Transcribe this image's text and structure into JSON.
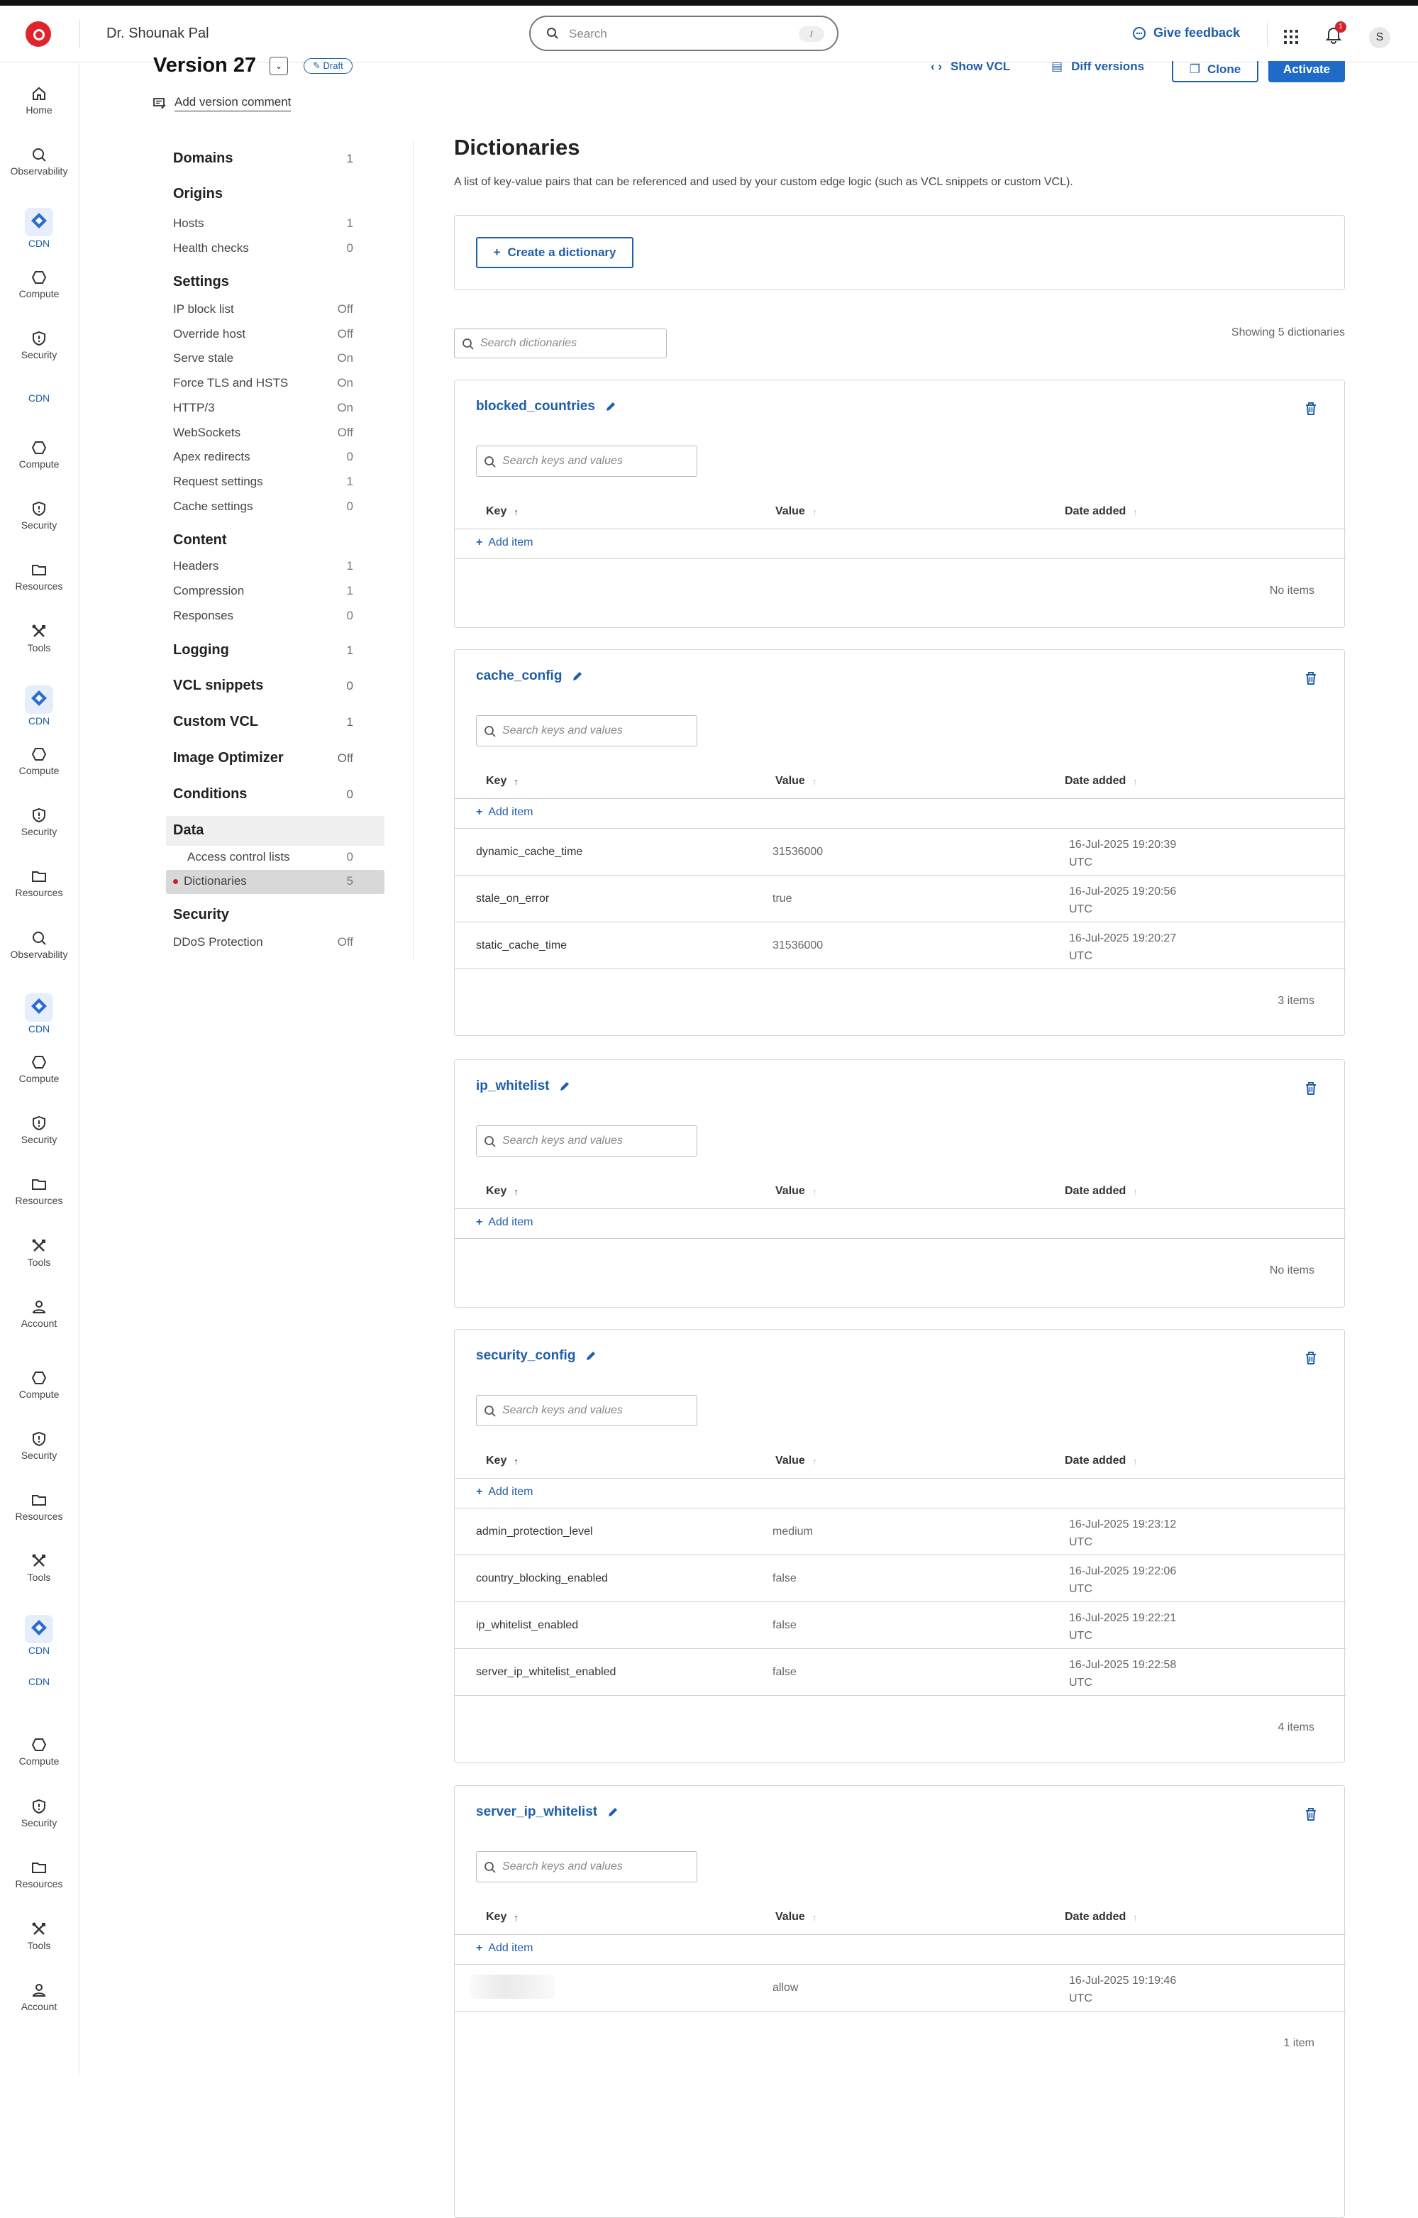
{
  "topbar": {
    "account_name": "Dr. Shounak Pal",
    "search_placeholder": "Search",
    "search_shortcut": "/",
    "feedback_label": "Give feedback",
    "notification_count": "1",
    "avatar_initial": "S"
  },
  "leftnav": {
    "items": [
      {
        "label": "Home",
        "icon": "home-icon"
      },
      {
        "label": "Observability",
        "icon": "observability-icon"
      },
      {
        "label": "CDN",
        "icon": "cdn-icon"
      },
      {
        "label": "Compute",
        "icon": "compute-icon"
      },
      {
        "label": "Security",
        "icon": "shield-icon"
      },
      {
        "label": "CDN",
        "icon": "cdn-text"
      },
      {
        "label": "Compute",
        "icon": "compute-icon"
      },
      {
        "label": "Security",
        "icon": "shield-icon"
      },
      {
        "label": "Resources",
        "icon": "folder-icon"
      },
      {
        "label": "Tools",
        "icon": "tools-icon"
      },
      {
        "label": "CDN",
        "icon": "cdn-icon"
      },
      {
        "label": "Compute",
        "icon": "compute-icon"
      },
      {
        "label": "Security",
        "icon": "shield-icon"
      },
      {
        "label": "Resources",
        "icon": "folder-icon"
      },
      {
        "label": "Observability",
        "icon": "observability-icon"
      },
      {
        "label": "CDN",
        "icon": "cdn-icon"
      },
      {
        "label": "Compute",
        "icon": "compute-icon"
      },
      {
        "label": "Security",
        "icon": "shield-icon"
      },
      {
        "label": "Resources",
        "icon": "folder-icon"
      },
      {
        "label": "Tools",
        "icon": "tools-icon"
      },
      {
        "label": "Account",
        "icon": "user-icon"
      },
      {
        "label": "Compute",
        "icon": "compute-icon"
      },
      {
        "label": "Security",
        "icon": "shield-icon"
      },
      {
        "label": "Resources",
        "icon": "folder-icon"
      },
      {
        "label": "Tools",
        "icon": "tools-icon"
      },
      {
        "label": "CDN",
        "icon": "cdn-icon"
      },
      {
        "label": "CDN",
        "icon": "cdn-text"
      },
      {
        "label": "Compute",
        "icon": "compute-icon"
      },
      {
        "label": "Security",
        "icon": "shield-icon"
      },
      {
        "label": "Resources",
        "icon": "folder-icon"
      },
      {
        "label": "Tools",
        "icon": "tools-icon"
      },
      {
        "label": "Account",
        "icon": "user-icon"
      }
    ]
  },
  "version": {
    "title": "Version 27",
    "status": "Draft",
    "comment_link": "Add version comment",
    "show_vcl": "Show VCL",
    "diff_versions": "Diff versions",
    "clone": "Clone",
    "activate": "Activate"
  },
  "subnav": {
    "domains": {
      "label": "Domains",
      "value": "1"
    },
    "origins": {
      "label": "Origins"
    },
    "hosts": {
      "label": "Hosts",
      "value": "1"
    },
    "health_checks": {
      "label": "Health checks",
      "value": "0"
    },
    "settings": {
      "label": "Settings"
    },
    "ip_block_list": {
      "label": "IP block list",
      "value": "Off"
    },
    "override_host": {
      "label": "Override host",
      "value": "Off"
    },
    "serve_stale": {
      "label": "Serve stale",
      "value": "On"
    },
    "force_tls": {
      "label": "Force TLS and HSTS",
      "value": "On"
    },
    "http3": {
      "label": "HTTP/3",
      "value": "On"
    },
    "websockets": {
      "label": "WebSockets",
      "value": "Off"
    },
    "apex_redirects": {
      "label": "Apex redirects",
      "value": "0"
    },
    "request_settings": {
      "label": "Request settings",
      "value": "1"
    },
    "cache_settings": {
      "label": "Cache settings",
      "value": "0"
    },
    "content": {
      "label": "Content"
    },
    "headers": {
      "label": "Headers",
      "value": "1"
    },
    "compression": {
      "label": "Compression",
      "value": "1"
    },
    "responses": {
      "label": "Responses",
      "value": "0"
    },
    "logging": {
      "label": "Logging",
      "value": "1"
    },
    "vcl_snippets": {
      "label": "VCL snippets",
      "value": "0"
    },
    "custom_vcl": {
      "label": "Custom VCL",
      "value": "1"
    },
    "image_optimizer": {
      "label": "Image Optimizer",
      "value": "Off"
    },
    "conditions": {
      "label": "Conditions",
      "value": "0"
    },
    "data": {
      "label": "Data"
    },
    "acl": {
      "label": "Access control lists",
      "value": "0"
    },
    "dictionaries": {
      "label": "Dictionaries",
      "value": "5"
    },
    "security": {
      "label": "Security"
    },
    "ddos": {
      "label": "DDoS Protection",
      "value": "Off"
    }
  },
  "main": {
    "title": "Dictionaries",
    "description": "A list of key-value pairs that can be referenced and used by your custom edge logic (such as VCL snippets or custom VCL).",
    "create_button": "Create a dictionary",
    "search_placeholder": "Search dictionaries",
    "showing": "Showing 5 dictionaries"
  },
  "table_labels": {
    "search_placeholder": "Search keys and values",
    "col_key": "Key",
    "col_value": "Value",
    "col_date": "Date added",
    "add_item": "Add item"
  },
  "dictionaries": [
    {
      "name": "blocked_countries",
      "footer": "No items",
      "rows": []
    },
    {
      "name": "cache_config",
      "footer": "3 items",
      "rows": [
        {
          "key": "dynamic_cache_time",
          "value": "31536000",
          "date": "16-Jul-2025 19:20:39",
          "tz": "UTC"
        },
        {
          "key": "stale_on_error",
          "value": "true",
          "date": "16-Jul-2025 19:20:56",
          "tz": "UTC"
        },
        {
          "key": "static_cache_time",
          "value": "31536000",
          "date": "16-Jul-2025 19:20:27",
          "tz": "UTC"
        }
      ]
    },
    {
      "name": "ip_whitelist",
      "footer": "No items",
      "rows": []
    },
    {
      "name": "security_config",
      "footer": "4 items",
      "rows": [
        {
          "key": "admin_protection_level",
          "value": "medium",
          "date": "16-Jul-2025 19:23:12",
          "tz": "UTC"
        },
        {
          "key": "country_blocking_enabled",
          "value": "false",
          "date": "16-Jul-2025 19:22:06",
          "tz": "UTC"
        },
        {
          "key": "ip_whitelist_enabled",
          "value": "false",
          "date": "16-Jul-2025 19:22:21",
          "tz": "UTC"
        },
        {
          "key": "server_ip_whitelist_enabled",
          "value": "false",
          "date": "16-Jul-2025 19:22:58",
          "tz": "UTC"
        }
      ]
    },
    {
      "name": "server_ip_whitelist",
      "footer": "1 item",
      "rows": [
        {
          "key": "",
          "value": "allow",
          "date": "16-Jul-2025 19:19:46",
          "tz": "UTC",
          "redacted": true
        }
      ]
    }
  ],
  "colors": {
    "accent": "#1f5ea8",
    "primary_button": "#1f6bc7",
    "brand": "#e0242d"
  }
}
